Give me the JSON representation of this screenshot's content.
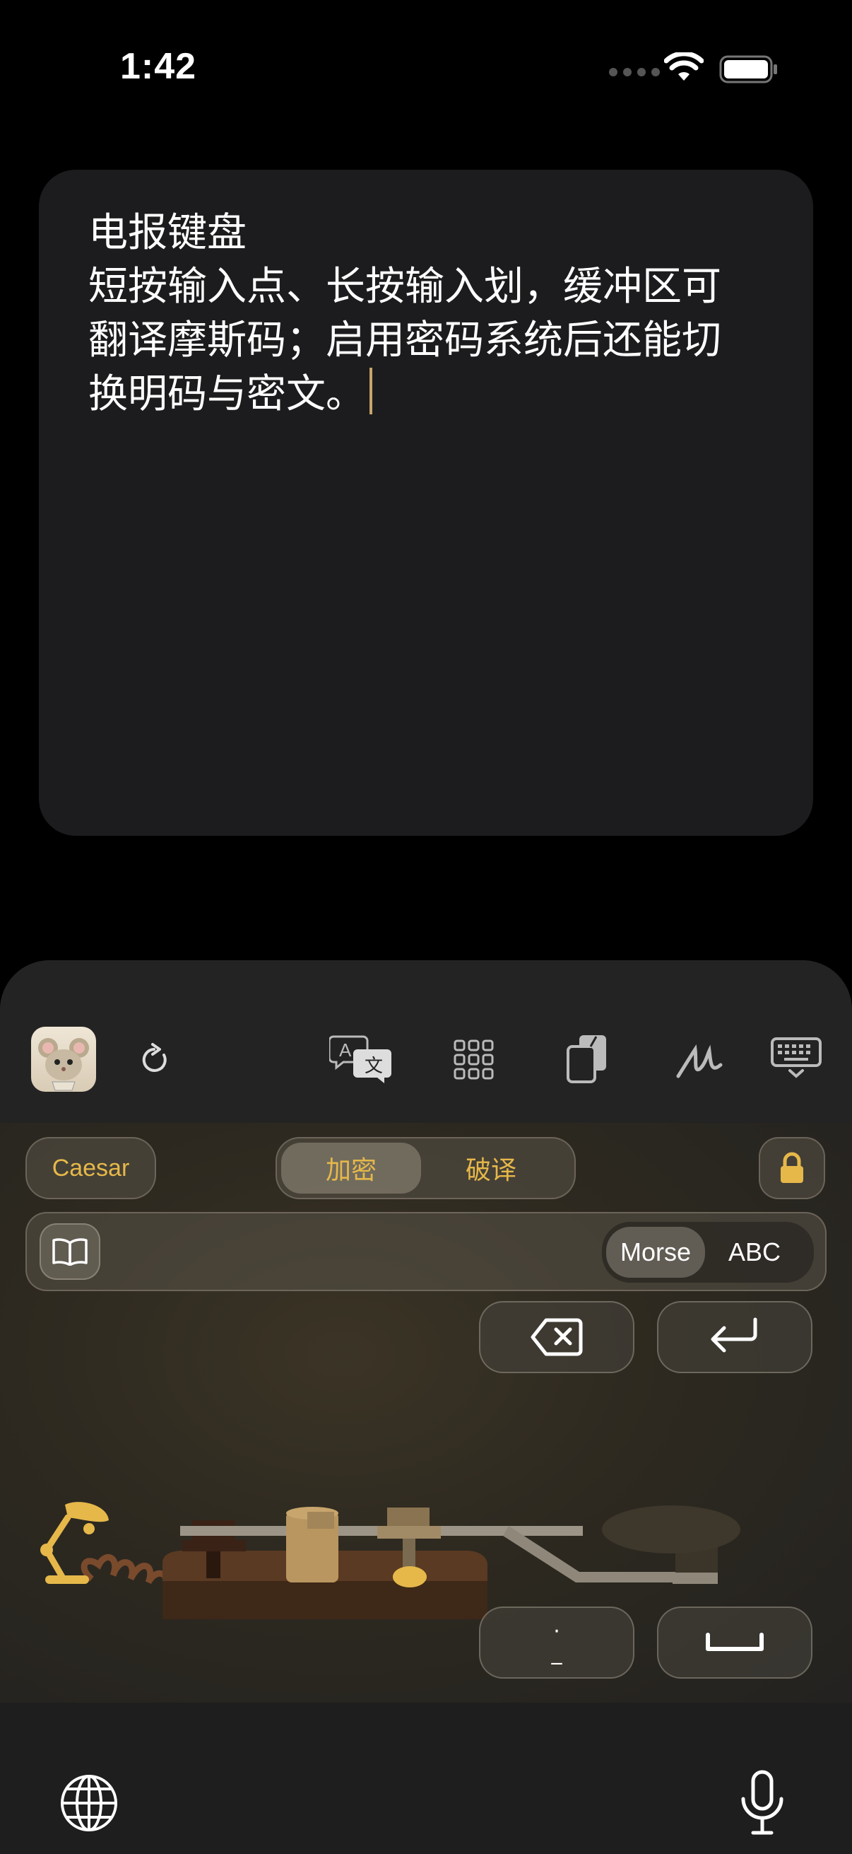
{
  "status_bar": {
    "time": "1:42"
  },
  "note": {
    "lines": [
      "电报键盘",
      "短按输入点、长按输入划，缓冲区可",
      "翻译摩斯码；启用密码系统后还能切",
      "换明码与密文。"
    ]
  },
  "keyboard": {
    "toolbar_icons": [
      "app-icon",
      "refresh-icon",
      "translate-icon",
      "grid-icon",
      "clipboard-icon",
      "handwriting-icon",
      "keyboard-dismiss-icon"
    ],
    "cipher_label": "Caesar",
    "segment": {
      "encrypt": "加密",
      "decrypt": "破译",
      "selected": "加密"
    },
    "buffer_modes": {
      "morse": "Morse",
      "abc": "ABC",
      "selected": "Morse"
    },
    "dot_dash_key": {
      "dot": "·",
      "dash": "_"
    }
  },
  "colors": {
    "accent_gold": "#e6b84a",
    "note_bg": "#1c1c1e",
    "caret": "#c8a46b"
  }
}
